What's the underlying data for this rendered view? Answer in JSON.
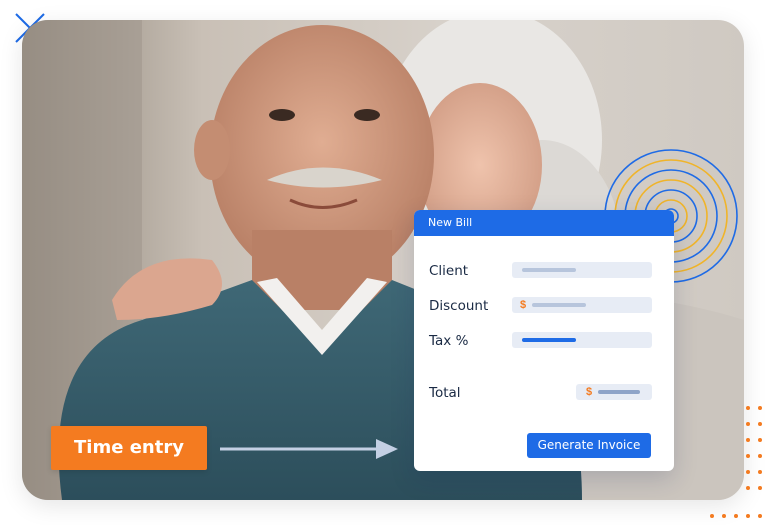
{
  "time_entry": {
    "label": "Time entry"
  },
  "bill": {
    "header": "New Bill",
    "fields": {
      "client_label": "Client",
      "discount_label": "Discount",
      "discount_currency": "$",
      "tax_label": "Tax %",
      "total_label": "Total",
      "total_currency": "$"
    },
    "generate_button": "Generate Invoice"
  },
  "colors": {
    "brand_blue": "#1e6be6",
    "accent_orange": "#f47b20"
  },
  "icons": {
    "corner_mark": "close-x-decoration",
    "rings": "concentric-rings-decoration",
    "dots": "dot-grid-decoration",
    "arrow": "arrow-right"
  }
}
